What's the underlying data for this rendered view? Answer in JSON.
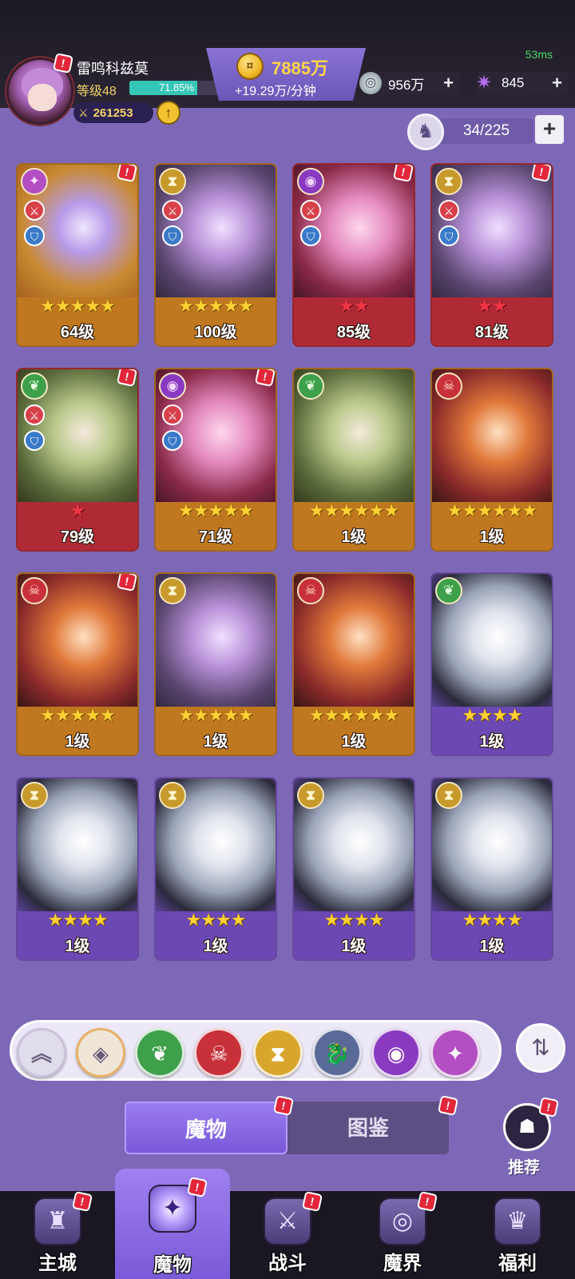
{
  "status": {
    "ping": "53ms"
  },
  "player": {
    "name": "雷鸣科兹莫",
    "level_label": "等级48",
    "xp_percent_text": "71.85%",
    "xp_fraction": 0.7185,
    "power": "261253",
    "upgrade_icon": "arrow-up-icon"
  },
  "currency": {
    "gold_amount": "7885万",
    "gold_rate": "+19.29万/分钟",
    "gold_icon": "gold-coin-icon",
    "silver_amount": "956万",
    "silver_icon": "silver-coin-icon",
    "gem_amount": "845",
    "gem_icon": "gem-icon",
    "plus_symbol": "+"
  },
  "roster": {
    "count": "34/225",
    "icon": "monster-roster-icon",
    "add_symbol": "+"
  },
  "monsters": [
    {
      "level": "64级",
      "stars": 5,
      "star_color": "gold",
      "frame": "orange",
      "element": "void",
      "element_glyph": "✦",
      "roles": true,
      "alert": true
    },
    {
      "level": "100级",
      "stars": 5,
      "star_color": "gold",
      "frame": "orange",
      "element": "time",
      "element_glyph": "⧗",
      "roles": true,
      "alert": false
    },
    {
      "level": "85级",
      "stars": 2,
      "star_color": "red",
      "frame": "red",
      "element": "eye",
      "element_glyph": "◉",
      "roles": true,
      "alert": true
    },
    {
      "level": "81级",
      "stars": 2,
      "star_color": "red",
      "frame": "red",
      "element": "time",
      "element_glyph": "⧗",
      "roles": true,
      "alert": true
    },
    {
      "level": "79级",
      "stars": 1,
      "star_color": "red",
      "frame": "red",
      "element": "nature",
      "element_glyph": "❦",
      "roles": true,
      "alert": true
    },
    {
      "level": "71级",
      "stars": 5,
      "star_color": "gold",
      "frame": "orange",
      "element": "eye",
      "element_glyph": "◉",
      "roles": true,
      "alert": true
    },
    {
      "level": "1级",
      "stars": 6,
      "star_color": "gold",
      "frame": "orange",
      "element": "nature",
      "element_glyph": "❦",
      "roles": false,
      "alert": false
    },
    {
      "level": "1级",
      "stars": 6,
      "star_color": "gold",
      "frame": "orange",
      "element": "chaos",
      "element_glyph": "☠",
      "roles": false,
      "alert": false
    },
    {
      "level": "1级",
      "stars": 5,
      "star_color": "gold",
      "frame": "orange",
      "element": "chaos",
      "element_glyph": "☠",
      "roles": false,
      "alert": true
    },
    {
      "level": "1级",
      "stars": 5,
      "star_color": "gold",
      "frame": "orange",
      "element": "time",
      "element_glyph": "⧗",
      "roles": false,
      "alert": false
    },
    {
      "level": "1级",
      "stars": 6,
      "star_color": "gold",
      "frame": "orange",
      "element": "chaos",
      "element_glyph": "☠",
      "roles": false,
      "alert": false
    },
    {
      "level": "1级",
      "stars": 4,
      "star_color": "gold",
      "frame": "purple",
      "element": "nature",
      "element_glyph": "❦",
      "roles": false,
      "alert": false
    },
    {
      "level": "1级",
      "stars": 4,
      "star_color": "gold",
      "frame": "purple",
      "element": "time",
      "element_glyph": "⧗",
      "roles": false,
      "alert": false
    },
    {
      "level": "1级",
      "stars": 4,
      "star_color": "gold",
      "frame": "purple",
      "element": "time",
      "element_glyph": "⧗",
      "roles": false,
      "alert": false
    },
    {
      "level": "1级",
      "stars": 4,
      "star_color": "gold",
      "frame": "purple",
      "element": "time",
      "element_glyph": "⧗",
      "roles": false,
      "alert": false
    },
    {
      "level": "1级",
      "stars": 4,
      "star_color": "gold",
      "frame": "purple",
      "element": "time",
      "element_glyph": "⧗",
      "roles": false,
      "alert": false
    }
  ],
  "filters": [
    {
      "name": "collapse",
      "glyph": "︽",
      "icon": "collapse-icon"
    },
    {
      "name": "all",
      "glyph": "◈",
      "icon": "all-elements-icon"
    },
    {
      "name": "nature",
      "glyph": "❦",
      "icon": "nature-element-icon"
    },
    {
      "name": "chaos",
      "glyph": "☠",
      "icon": "chaos-element-icon"
    },
    {
      "name": "time",
      "glyph": "⧗",
      "icon": "time-element-icon"
    },
    {
      "name": "dragon",
      "glyph": "🐉",
      "icon": "dragon-element-icon"
    },
    {
      "name": "eye",
      "glyph": "◉",
      "icon": "eye-element-icon"
    },
    {
      "name": "void",
      "glyph": "✦",
      "icon": "void-element-icon"
    }
  ],
  "sort_icon": "sort-icon",
  "tabs": [
    {
      "label": "魔物",
      "active": true
    },
    {
      "label": "图鉴",
      "active": false
    }
  ],
  "recommend": {
    "label": "推荐",
    "icon": "group-icon"
  },
  "nav": [
    {
      "label": "主城",
      "icon": "castle-icon",
      "glyph": "♜",
      "alert": true,
      "active": false
    },
    {
      "label": "魔物",
      "icon": "monster-flame-icon",
      "glyph": "✦",
      "alert": true,
      "active": true
    },
    {
      "label": "战斗",
      "icon": "shield-sword-icon",
      "glyph": "⚔",
      "alert": true,
      "active": false
    },
    {
      "label": "魔界",
      "icon": "portal-icon",
      "glyph": "◎",
      "alert": true,
      "active": false
    },
    {
      "label": "福利",
      "icon": "chest-icon",
      "glyph": "♛",
      "alert": false,
      "active": false
    }
  ],
  "alert_glyph": "!"
}
